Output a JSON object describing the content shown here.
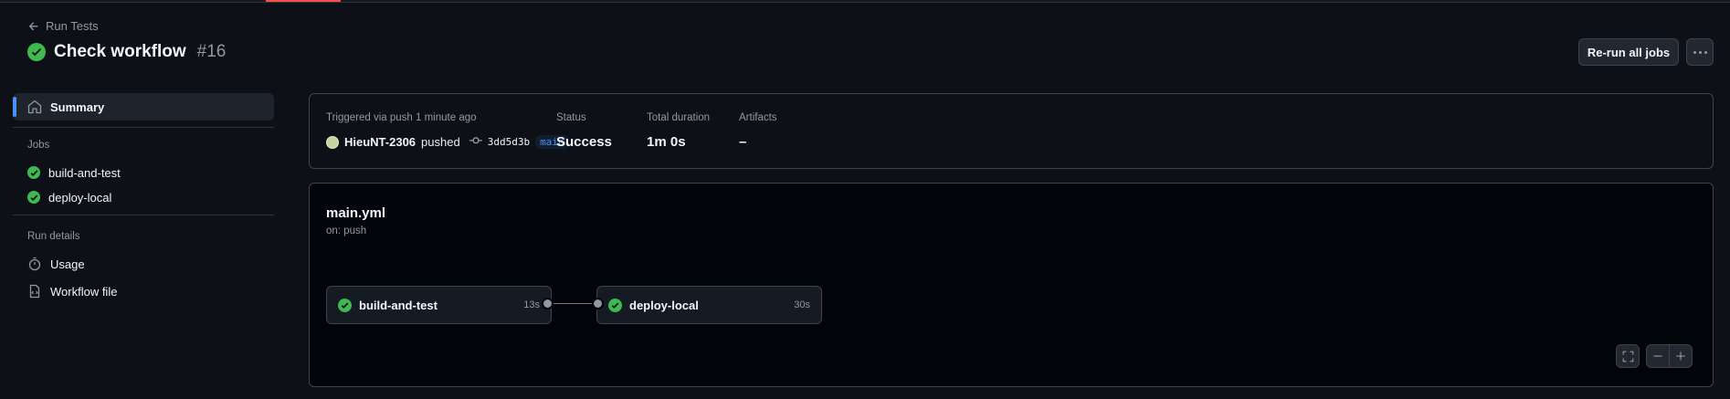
{
  "header": {
    "back_label": "Run Tests",
    "title": "Check workflow",
    "run_number": "#16",
    "rerun_label": "Re-run all jobs"
  },
  "sidebar": {
    "summary_label": "Summary",
    "jobs_heading": "Jobs",
    "jobs": [
      {
        "label": "build-and-test",
        "status": "success"
      },
      {
        "label": "deploy-local",
        "status": "success"
      }
    ],
    "run_details_heading": "Run details",
    "usage_label": "Usage",
    "workflow_file_label": "Workflow file"
  },
  "summary": {
    "trigger_label": "Triggered via push 1 minute ago",
    "user": "HieuNT-2306",
    "action": "pushed",
    "commit_sha": "3dd5d3b",
    "branch": "main",
    "status_label": "Status",
    "status_value": "Success",
    "duration_label": "Total duration",
    "duration_value": "1m 0s",
    "artifacts_label": "Artifacts",
    "artifacts_value": "–"
  },
  "graph": {
    "file_name": "main.yml",
    "trigger": "on: push",
    "jobs": [
      {
        "name": "build-and-test",
        "duration": "13s"
      },
      {
        "name": "deploy-local",
        "duration": "30s"
      }
    ]
  },
  "colors": {
    "success": "#3fb950",
    "accent": "#4493f8",
    "background": "#0d1117"
  }
}
